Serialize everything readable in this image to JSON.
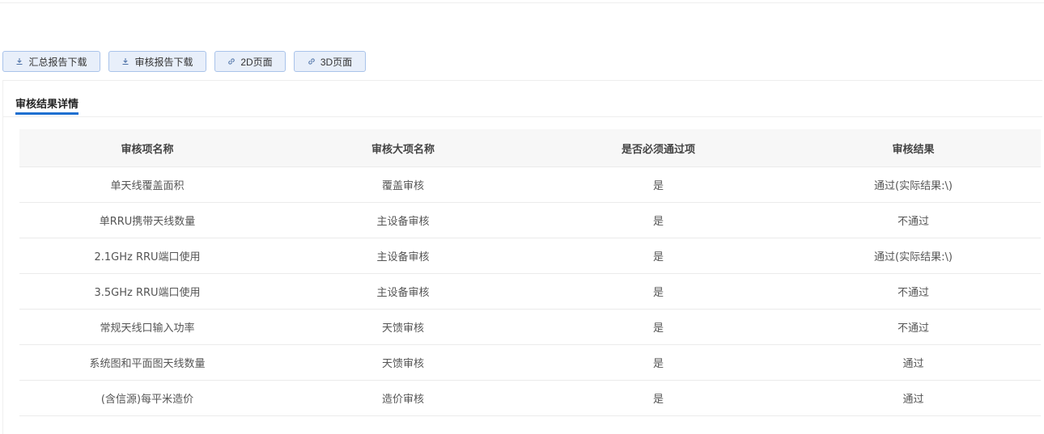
{
  "toolbar": {
    "buttons": [
      {
        "label": "汇总报告下载",
        "icon": "download-icon"
      },
      {
        "label": "审核报告下载",
        "icon": "download-icon"
      },
      {
        "label": "2D页面",
        "icon": "link-icon"
      },
      {
        "label": "3D页面",
        "icon": "link-icon"
      }
    ]
  },
  "panel": {
    "title": "审核结果详情"
  },
  "table": {
    "headers": [
      "审核项名称",
      "审核大项名称",
      "是否必须通过项",
      "审核结果"
    ],
    "rows": [
      [
        "单天线覆盖面积",
        "覆盖审核",
        "是",
        "通过(实际结果:\\)"
      ],
      [
        "单RRU携带天线数量",
        "主设备审核",
        "是",
        "不通过"
      ],
      [
        "2.1GHz RRU端口使用",
        "主设备审核",
        "是",
        "通过(实际结果:\\)"
      ],
      [
        "3.5GHz RRU端口使用",
        "主设备审核",
        "是",
        "不通过"
      ],
      [
        "常规天线口输入功率",
        "天馈审核",
        "是",
        "不通过"
      ],
      [
        "系统图和平面图天线数量",
        "天馈审核",
        "是",
        "通过"
      ],
      [
        "(含信源)每平米造价",
        "造价审核",
        "是",
        "通过"
      ]
    ]
  },
  "colors": {
    "accent": "#1e6fd0",
    "button_bg": "#e8effa",
    "button_border": "#a9c3ea",
    "header_bg": "#f7f7f7"
  }
}
